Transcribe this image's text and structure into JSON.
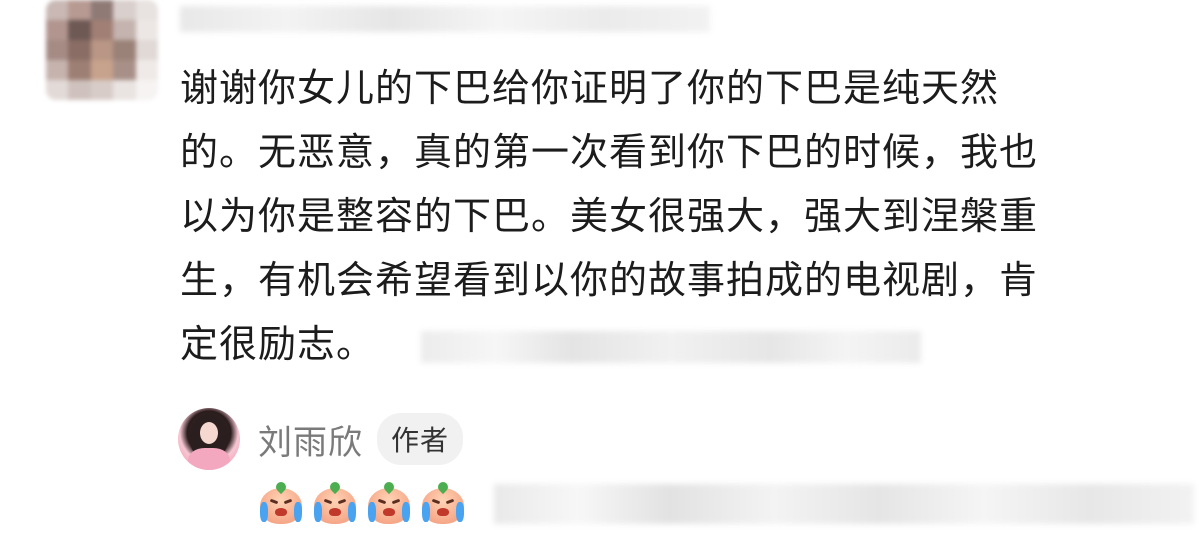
{
  "comment": {
    "avatar_icon": "blurred-avatar",
    "username_obscured": true,
    "text_lines": [
      "谢谢你女儿的下巴给你证明了你的下巴是纯天然",
      "的。无恶意，真的第一次看到你下巴的时候，我也",
      "以为你是整容的下巴。美女很强大，强大到涅槃重",
      "生，有机会希望看到以你的故事拍成的电视剧，肯",
      "定很励志。"
    ]
  },
  "reply": {
    "author_name": "刘雨欣",
    "author_badge": "作者",
    "avatar_icon": "author-avatar",
    "emoji_icon": "crying-face-icon",
    "emoji_count": 4
  },
  "colors": {
    "text": "#1c1c1c",
    "author_name": "#7a7a7a",
    "badge_bg": "#f1f1f1"
  }
}
